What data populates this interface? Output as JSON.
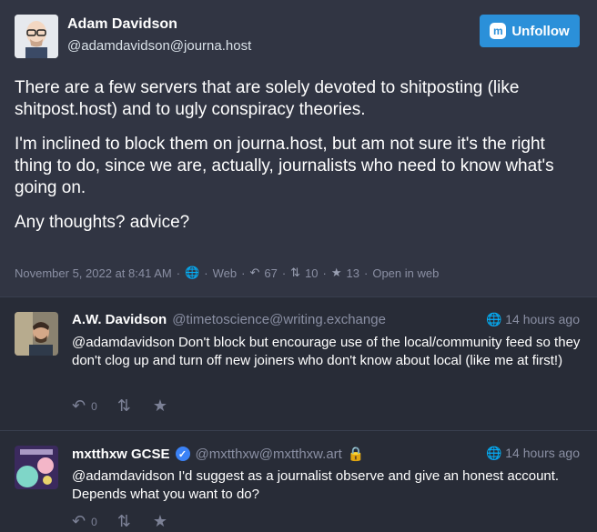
{
  "post": {
    "author_name": "Adam Davidson",
    "author_handle": "@adamdavidson@journa.host",
    "follow_button_label": "Unfollow",
    "paragraphs": [
      "There are a few servers that are solely devoted to shitposting (like shitpost.host) and to ugly conspiracy theories.",
      "I'm inclined to block them on journa.host, but am not sure it's the right thing to do, since we are, actually, journalists who need to know what's going on.",
      "Any thoughts? advice?"
    ],
    "timestamp": "November 5, 2022 at 8:41 AM",
    "visibility_sep": "·",
    "client": "Web",
    "reply_count": "67",
    "boost_count": "10",
    "favourite_count": "13",
    "open_in_web": "Open in web"
  },
  "replies": [
    {
      "name": "A.W. Davidson",
      "handle": "@timetoscience@writing.exchange",
      "time": "14 hours ago",
      "text": "@adamdavidson Don't block but encourage use of the local/community feed so they don't clog up and turn off new joiners who don't know about local (like me at first!)",
      "reply_count": "0"
    },
    {
      "name": "mxtthxw GCSE",
      "handle": "@mxtthxw@mxtthxw.art",
      "time": "14 hours ago",
      "text": "@adamdavidson I'd suggest as a journalist observe and give an honest account. Depends what you want to do?",
      "reply_count": "0"
    }
  ],
  "colors": {
    "accent": "#2b90d9",
    "background": "#282c37",
    "panel": "#313543",
    "muted": "#8a8fa3"
  }
}
